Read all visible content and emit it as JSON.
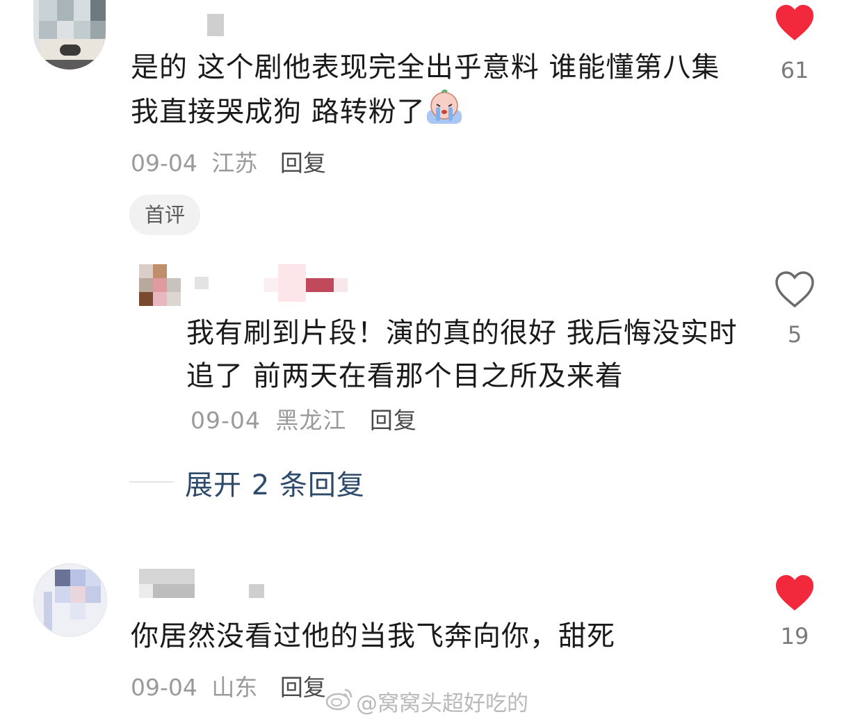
{
  "comments": [
    {
      "text": "是的 这个剧他表现完全出乎意料 谁能懂第八集我直接哭成狗 路转粉了",
      "date": "09-04",
      "location": "江苏",
      "reply_label": "回复",
      "badge": "首评",
      "likes": "61",
      "liked": true
    },
    {
      "text": "我有刷到片段！演的真的很好 我后悔没实时追了 前两天在看那个目之所及来着",
      "date": "09-04",
      "location": "黑龙江",
      "reply_label": "回复",
      "likes": "5",
      "liked": false
    },
    {
      "text": "你居然没看过他的当我飞奔向你，甜死",
      "date": "09-04",
      "location": "山东",
      "reply_label": "回复",
      "likes": "19",
      "liked": true
    }
  ],
  "expand_replies": "展开 2 条回复",
  "watermark": "@窝窝头超好吃的",
  "colors": {
    "heart_red": "#f2283c",
    "link_blue": "#2d4a6b"
  },
  "icons": [
    "heart-filled-icon",
    "heart-outline-icon",
    "crying-emoji-icon",
    "weibo-logo-icon"
  ]
}
